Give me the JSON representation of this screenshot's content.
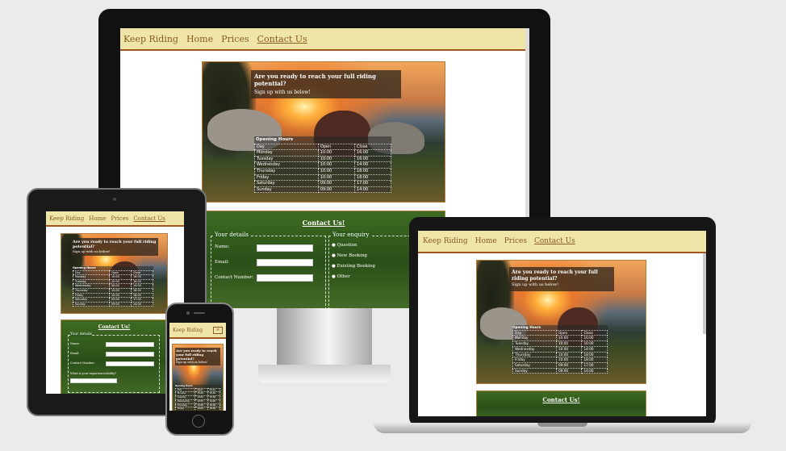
{
  "site": {
    "brand": "Keep Riding",
    "nav": [
      "Home",
      "Prices",
      "Contact Us"
    ],
    "cta_title": "Are you ready to reach your full riding potential?",
    "cta_sub": "Sign up with us below!",
    "hours_title": "Opening Hours",
    "hours_cols": [
      "Day",
      "Open",
      "Close"
    ],
    "hours_rows": [
      [
        "Monday",
        "10:00",
        "16:00"
      ],
      [
        "Tuesday",
        "10:00",
        "16:00"
      ],
      [
        "Wednesday",
        "10:00",
        "14:00"
      ],
      [
        "Thursday",
        "10:00",
        "18:00"
      ],
      [
        "Friday",
        "10:00",
        "18:00"
      ],
      [
        "Saturday",
        "09:00",
        "17:00"
      ],
      [
        "Sunday",
        "09:00",
        "14:00"
      ]
    ],
    "contact_title": "Contact Us!",
    "details_legend": "Your details",
    "fields": [
      "Name:",
      "Email:",
      "Contact Number:"
    ],
    "enquiry_legend": "Your enquiry",
    "enquiry_options": [
      "Question",
      "New Booking",
      "Existing Booking",
      "Other"
    ],
    "experience_label": "What is your experience/ability?"
  },
  "colors": {
    "nav_bg": "#efe5a8",
    "nav_text": "#8a5a1e",
    "accent_border": "#a0551e",
    "page_bg": "#ebebeb"
  }
}
